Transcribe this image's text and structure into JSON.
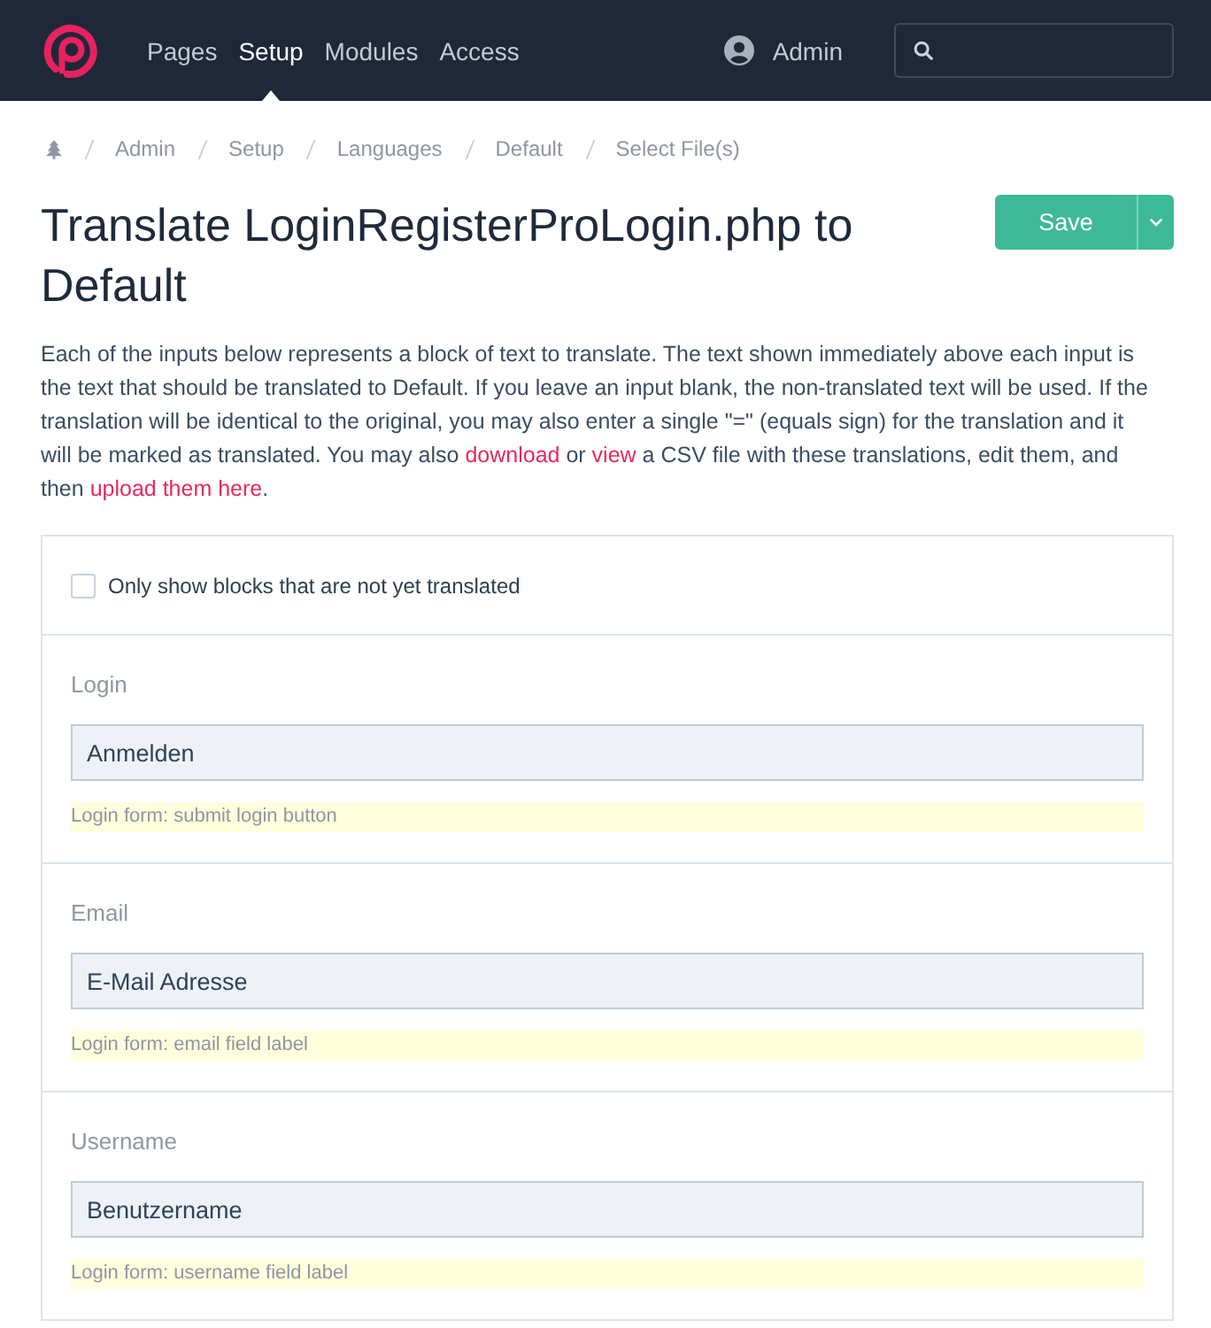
{
  "header": {
    "nav": [
      {
        "label": "Pages",
        "selected": false
      },
      {
        "label": "Setup",
        "selected": true
      },
      {
        "label": "Modules",
        "selected": false
      },
      {
        "label": "Access",
        "selected": false
      }
    ],
    "user": {
      "name": "Admin"
    }
  },
  "breadcrumb": [
    "Admin",
    "Setup",
    "Languages",
    "Default",
    "Select File(s)"
  ],
  "title": "Translate LoginRegisterProLogin.php to Default",
  "save_button": {
    "label": "Save"
  },
  "intro": [
    {
      "kind": "text",
      "text": "Each of the inputs below represents a block of text to translate. The text shown immediately above each input is the text that should be translated to Default. If you leave an input blank, the non-translated text will be used. If the translation will be identical to the original, you may also enter a single \"=\" (equals sign) for the translation and it will be marked as translated. You may also "
    },
    {
      "kind": "link",
      "text": "download"
    },
    {
      "kind": "text",
      "text": " or "
    },
    {
      "kind": "link",
      "text": "view"
    },
    {
      "kind": "text",
      "text": " a CSV file with these translations, edit them, and then "
    },
    {
      "kind": "link",
      "text": "upload them here"
    },
    {
      "kind": "text",
      "text": "."
    }
  ],
  "filter": {
    "label": "Only show blocks that are not yet translated",
    "checked": false
  },
  "blocks": [
    {
      "source": "Login",
      "value": "Anmelden",
      "note": "Login form: submit login button"
    },
    {
      "source": "Email",
      "value": "E-Mail Adresse",
      "note": "Login form: email field label"
    },
    {
      "source": "Username",
      "value": "Benutzername",
      "note": "Login form: username field label"
    }
  ]
}
